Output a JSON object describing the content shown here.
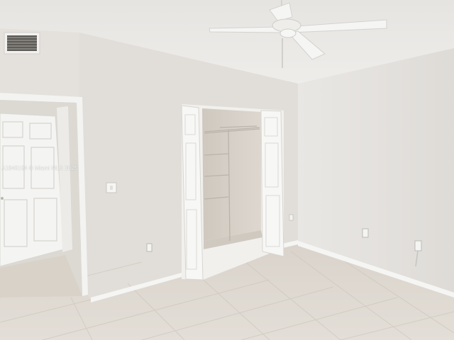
{
  "photo": {
    "watermark": "A1846194 © Miami MLS 2025",
    "palette": {
      "ceiling": "#ebe9e6",
      "wall_left": "#e6e3de",
      "wall_center": "#e2dfda",
      "wall_right": "#e4e2df",
      "floor": "#ddd8d0",
      "trim": "#f6f6f4",
      "closet_interior": "#d8d2ca"
    }
  }
}
